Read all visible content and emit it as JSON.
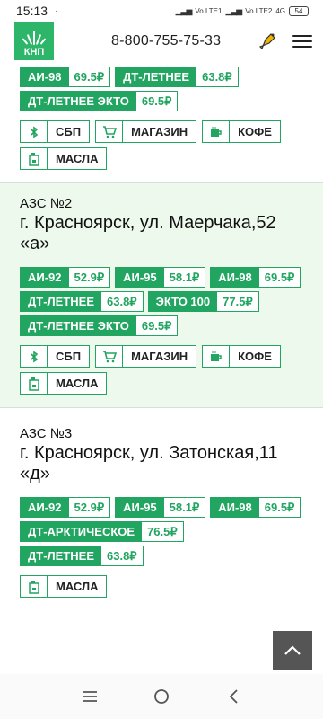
{
  "status": {
    "time": "15:13",
    "net1": "Vo LTE1",
    "net2": "Vo LTE2",
    "net3": "4G",
    "battery": "54"
  },
  "header": {
    "logo_text": "КНП",
    "phone": "8-800-755-75-33",
    "brand_color": "#2db56a"
  },
  "top_partial": {
    "fuels": [
      {
        "name": "АИ-98",
        "price": "69.5₽"
      },
      {
        "name": "ДТ-ЛЕТНЕЕ",
        "price": "63.8₽"
      },
      {
        "name": "ДТ-ЛЕТНЕЕ ЭКТО",
        "price": "69.5₽"
      }
    ],
    "services": [
      {
        "icon": "bluetooth-icon",
        "label": "СБП"
      },
      {
        "icon": "cart-icon",
        "label": "МАГАЗИН"
      },
      {
        "icon": "coffee-icon",
        "label": "КОФЕ"
      },
      {
        "icon": "oil-can-icon",
        "label": "МАСЛА"
      }
    ]
  },
  "stations": [
    {
      "title": "АЗС №2",
      "address": "г. Красноярск, ул. Маерчака,52 «а»",
      "fuels": [
        {
          "name": "АИ-92",
          "price": "52.9₽"
        },
        {
          "name": "АИ-95",
          "price": "58.1₽"
        },
        {
          "name": "АИ-98",
          "price": "69.5₽"
        },
        {
          "name": "ДТ-ЛЕТНЕЕ",
          "price": "63.8₽"
        },
        {
          "name": "ЭКТО 100",
          "price": "77.5₽"
        },
        {
          "name": "ДТ-ЛЕТНЕЕ ЭКТО",
          "price": "69.5₽"
        }
      ],
      "services": [
        {
          "icon": "bluetooth-icon",
          "label": "СБП"
        },
        {
          "icon": "cart-icon",
          "label": "МАГАЗИН"
        },
        {
          "icon": "coffee-icon",
          "label": "КОФЕ"
        },
        {
          "icon": "oil-can-icon",
          "label": "МАСЛА"
        }
      ]
    },
    {
      "title": "АЗС №3",
      "address": "г. Красноярск, ул. Затонская,11 «д»",
      "fuels": [
        {
          "name": "АИ-92",
          "price": "52.9₽"
        },
        {
          "name": "АИ-95",
          "price": "58.1₽"
        },
        {
          "name": "АИ-98",
          "price": "69.5₽"
        },
        {
          "name": "ДТ-АРКТИЧЕСКОЕ",
          "price": "76.5₽"
        },
        {
          "name": "ДТ-ЛЕТНЕЕ",
          "price": "63.8₽"
        }
      ],
      "services": [
        {
          "icon": "oil-can-icon",
          "label": "МАСЛА"
        }
      ]
    }
  ],
  "colors": {
    "accent": "#21a560",
    "highlight_bg": "#eef9ed"
  }
}
